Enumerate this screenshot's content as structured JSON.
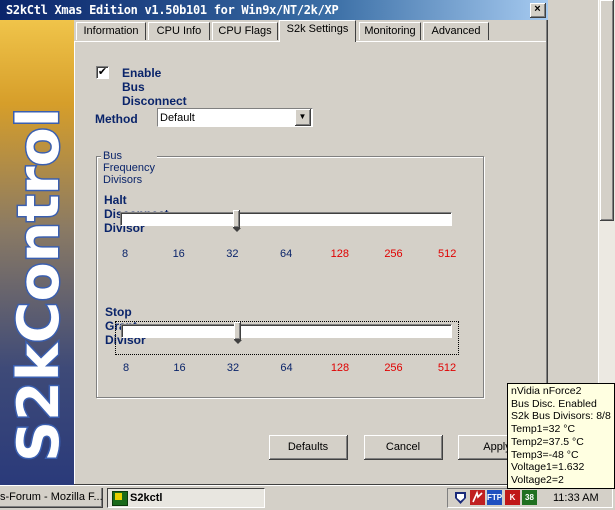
{
  "window": {
    "title": "S2kCtl Xmas Edition v1.50b101 for Win9x/NT/2k/XP",
    "close_glyph": "×"
  },
  "banner": {
    "text": "S2kControl"
  },
  "tabs": [
    {
      "label": "Information",
      "active": false
    },
    {
      "label": "CPU Info",
      "active": false
    },
    {
      "label": "CPU Flags",
      "active": false
    },
    {
      "label": "S2k Settings",
      "active": true
    },
    {
      "label": "Monitoring",
      "active": false
    },
    {
      "label": "Advanced",
      "active": false
    }
  ],
  "settings": {
    "enable_bus_disconnect": {
      "label": "Enable Bus Disconnect",
      "checked": true,
      "glyph": "✔"
    },
    "method": {
      "label": "Method",
      "value": "Default",
      "arrow": "▼"
    },
    "group_title": "Bus Frequency Divisors",
    "halt": {
      "label": "Halt Disconnect Divisor",
      "value": 32,
      "ticks": [
        {
          "label": "8",
          "color": "blue"
        },
        {
          "label": "16",
          "color": "blue"
        },
        {
          "label": "32",
          "color": "blue"
        },
        {
          "label": "64",
          "color": "blue"
        },
        {
          "label": "128",
          "color": "red"
        },
        {
          "label": "256",
          "color": "red"
        },
        {
          "label": "512",
          "color": "red"
        }
      ]
    },
    "stop_grant": {
      "label": "Stop Grant Divisor",
      "value": 32,
      "ticks": [
        {
          "label": "8",
          "color": "blue"
        },
        {
          "label": "16",
          "color": "blue"
        },
        {
          "label": "32",
          "color": "blue"
        },
        {
          "label": "64",
          "color": "blue"
        },
        {
          "label": "128",
          "color": "red"
        },
        {
          "label": "256",
          "color": "red"
        },
        {
          "label": "512",
          "color": "red"
        }
      ]
    }
  },
  "buttons": {
    "defaults": "Defaults",
    "cancel": "Cancel",
    "apply": "Apply"
  },
  "tooltip": {
    "lines": [
      "nVidia nForce2",
      "Bus Disc. Enabled",
      "S2k Bus Divisors: 8/8",
      "Temp1=32 °C",
      "Temp2=37.5 °C",
      "Temp3=-48 °C",
      "Voltage1=1.632",
      "Voltage2=2"
    ]
  },
  "taskbar": {
    "tasks": [
      {
        "label": "s-Forum - Mozilla F...",
        "active": false
      },
      {
        "label": "S2kctl",
        "active": true
      }
    ],
    "tray": {
      "icons": [
        {
          "name": "shield-icon",
          "color": "#1a2a7a"
        },
        {
          "name": "network-icon",
          "color": "#c02020"
        },
        {
          "name": "ftp-icon",
          "label": "FTP",
          "color": "#2050c0"
        },
        {
          "name": "antivirus-icon",
          "label": "K",
          "color": "#c01818"
        },
        {
          "name": "counter-icon",
          "label": "38",
          "color": "#207020"
        }
      ],
      "clock": "11:33 AM"
    }
  },
  "colors": {
    "title_gradient_start": "#0a246a",
    "label_blue": "#0a246a",
    "tick_blue": "#0a246a",
    "tick_red": "#e00000",
    "tooltip_bg": "#ffffe1",
    "face": "#d4d0c8"
  }
}
